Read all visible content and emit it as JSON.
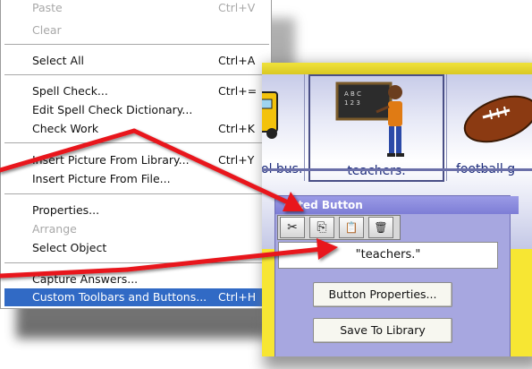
{
  "menu": {
    "items": [
      {
        "label": "Paste",
        "shortcut": "Ctrl+V",
        "disabled": true
      },
      {
        "label": "Clear",
        "shortcut": "",
        "disabled": true
      },
      {
        "label": "Select All",
        "shortcut": "Ctrl+A"
      },
      {
        "label": "Spell Check...",
        "shortcut": "Ctrl+="
      },
      {
        "label": "Edit Spell Check Dictionary...",
        "shortcut": ""
      },
      {
        "label": "Check Work",
        "shortcut": "Ctrl+K"
      },
      {
        "label": "Insert Picture From Library...",
        "shortcut": "Ctrl+Y"
      },
      {
        "label": "Insert Picture From File...",
        "shortcut": ""
      },
      {
        "label": "Properties...",
        "shortcut": ""
      },
      {
        "label": "Arrange",
        "shortcut": "",
        "disabled": true
      },
      {
        "label": "Select Object",
        "shortcut": ""
      },
      {
        "label": "Capture Answers...",
        "shortcut": ""
      },
      {
        "label": "Custom Toolbars and Buttons...",
        "shortcut": "Ctrl+H",
        "selected": true
      }
    ]
  },
  "buttons_row": {
    "captions": [
      "ol bus.",
      "teachers.",
      "football g"
    ]
  },
  "selected_panel": {
    "title": "ected Button",
    "tools": [
      {
        "icon": "scissors-icon",
        "glyph": "✂"
      },
      {
        "icon": "copy-icon",
        "glyph": "⎘"
      },
      {
        "icon": "paste-icon",
        "glyph": "📋"
      },
      {
        "icon": "trash-icon",
        "glyph": "🗑"
      }
    ],
    "name_value": "\"teachers.\"",
    "properties_button": "Button Properties...",
    "save_button": "Save To Library"
  },
  "colors": {
    "accent_red": "#e8141b",
    "menu_highlight": "#316ac5",
    "panel_yellow": "#f7e633",
    "panel_lavender": "#a7a7e0"
  }
}
